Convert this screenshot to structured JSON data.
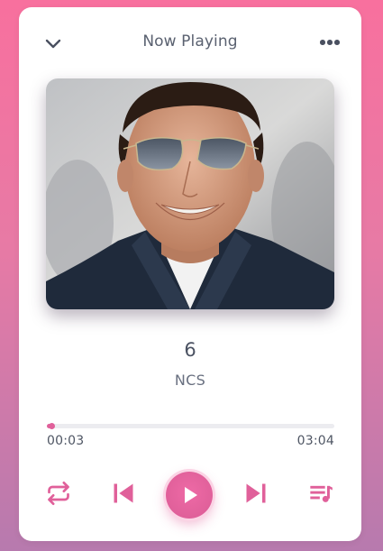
{
  "header": {
    "title": "Now Playing",
    "collapse_icon": "chevron-down-icon",
    "menu_icon": "more-horizontal-icon"
  },
  "track": {
    "title": "6",
    "artist": "NCS"
  },
  "progress": {
    "current_time": "00:03",
    "duration": "03:04",
    "fraction": 0.016
  },
  "controls": {
    "repeat_icon": "repeat-icon",
    "previous_icon": "skip-previous-icon",
    "play_icon": "play-icon",
    "next_icon": "skip-next-icon",
    "queue_icon": "playlist-icon"
  },
  "colors": {
    "accent": "#e0609a",
    "background_top": "#f8709e",
    "background_bottom": "#b77aae",
    "text": "#5a6170"
  }
}
